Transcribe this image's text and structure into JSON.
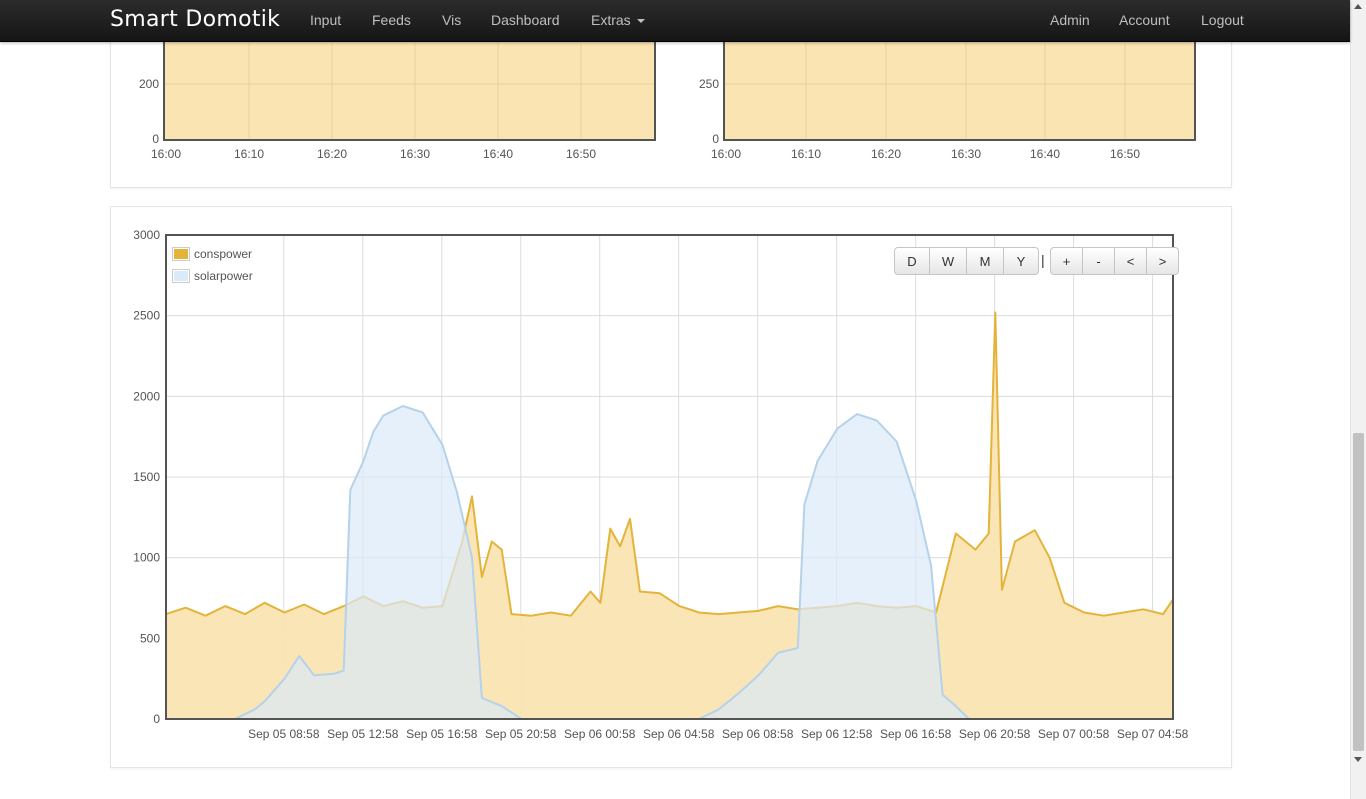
{
  "navbar": {
    "brand": "Smart Domotik",
    "items": [
      "Input",
      "Feeds",
      "Vis",
      "Dashboard",
      "Extras"
    ],
    "right_items": [
      "Admin",
      "Account",
      "Logout"
    ]
  },
  "top_charts": [
    {
      "y_ticks": [
        "0",
        "200"
      ],
      "x_ticks": [
        "16:00",
        "16:10",
        "16:20",
        "16:30",
        "16:40",
        "16:50"
      ]
    },
    {
      "y_ticks": [
        "0",
        "250"
      ],
      "x_ticks": [
        "16:00",
        "16:10",
        "16:20",
        "16:30",
        "16:40",
        "16:50"
      ]
    }
  ],
  "controls": {
    "range_buttons": [
      "D",
      "W",
      "M",
      "Y"
    ],
    "separator": "|",
    "nav_buttons": [
      "+",
      "-",
      "<",
      ">"
    ]
  },
  "colors": {
    "conspower_line": "#e4b43a",
    "conspower_fill": "#f9e4b2",
    "solarpower_line": "#b5d2ea",
    "solarpower_fill": "#dbeaf8"
  },
  "chart_data": {
    "type": "area",
    "legend_position": "top-left",
    "grid": true,
    "ylim": [
      0,
      3000
    ],
    "y_ticks": [
      0,
      500,
      1000,
      1500,
      2000,
      2500,
      3000
    ],
    "x_range": [
      "Sep 05 03:00",
      "Sep 07 06:00"
    ],
    "x_ticks": [
      "Sep 05 08:58",
      "Sep 05 12:58",
      "Sep 05 16:58",
      "Sep 05 20:58",
      "Sep 06 00:58",
      "Sep 06 04:58",
      "Sep 06 08:58",
      "Sep 06 12:58",
      "Sep 06 16:58",
      "Sep 06 20:58",
      "Sep 07 00:58",
      "Sep 07 04:58"
    ],
    "series": [
      {
        "name": "conspower",
        "points": [
          [
            "Sep 05 03:00",
            650
          ],
          [
            "Sep 05 04:00",
            690
          ],
          [
            "Sep 05 05:00",
            640
          ],
          [
            "Sep 05 06:00",
            700
          ],
          [
            "Sep 05 07:00",
            650
          ],
          [
            "Sep 05 08:00",
            720
          ],
          [
            "Sep 05 09:00",
            660
          ],
          [
            "Sep 05 10:00",
            710
          ],
          [
            "Sep 05 11:00",
            650
          ],
          [
            "Sep 05 12:00",
            700
          ],
          [
            "Sep 05 13:00",
            760
          ],
          [
            "Sep 05 14:00",
            700
          ],
          [
            "Sep 05 15:00",
            730
          ],
          [
            "Sep 05 16:00",
            690
          ],
          [
            "Sep 05 17:00",
            700
          ],
          [
            "Sep 05 18:00",
            1100
          ],
          [
            "Sep 05 18:30",
            1380
          ],
          [
            "Sep 05 19:00",
            880
          ],
          [
            "Sep 05 19:30",
            1100
          ],
          [
            "Sep 05 20:00",
            1050
          ],
          [
            "Sep 05 20:30",
            650
          ],
          [
            "Sep 05 21:30",
            640
          ],
          [
            "Sep 05 22:30",
            660
          ],
          [
            "Sep 05 23:30",
            640
          ],
          [
            "Sep 06 00:30",
            790
          ],
          [
            "Sep 06 01:00",
            720
          ],
          [
            "Sep 06 01:30",
            1180
          ],
          [
            "Sep 06 02:00",
            1070
          ],
          [
            "Sep 06 02:30",
            1240
          ],
          [
            "Sep 06 03:00",
            790
          ],
          [
            "Sep 06 04:00",
            780
          ],
          [
            "Sep 06 05:00",
            700
          ],
          [
            "Sep 06 06:00",
            660
          ],
          [
            "Sep 06 07:00",
            650
          ],
          [
            "Sep 06 08:00",
            660
          ],
          [
            "Sep 06 09:00",
            670
          ],
          [
            "Sep 06 10:00",
            700
          ],
          [
            "Sep 06 11:00",
            680
          ],
          [
            "Sep 06 12:00",
            690
          ],
          [
            "Sep 06 13:00",
            700
          ],
          [
            "Sep 06 14:00",
            720
          ],
          [
            "Sep 06 15:00",
            700
          ],
          [
            "Sep 06 16:00",
            690
          ],
          [
            "Sep 06 17:00",
            700
          ],
          [
            "Sep 06 18:00",
            660
          ],
          [
            "Sep 06 19:00",
            1150
          ],
          [
            "Sep 06 20:00",
            1050
          ],
          [
            "Sep 06 20:40",
            1150
          ],
          [
            "Sep 06 21:00",
            2520
          ],
          [
            "Sep 06 21:20",
            800
          ],
          [
            "Sep 06 22:00",
            1100
          ],
          [
            "Sep 06 23:00",
            1170
          ],
          [
            "Sep 06 23:45",
            1000
          ],
          [
            "Sep 07 00:30",
            720
          ],
          [
            "Sep 07 01:30",
            660
          ],
          [
            "Sep 07 02:30",
            640
          ],
          [
            "Sep 07 03:30",
            660
          ],
          [
            "Sep 07 04:30",
            680
          ],
          [
            "Sep 07 05:30",
            650
          ],
          [
            "Sep 07 06:00",
            740
          ]
        ]
      },
      {
        "name": "solarpower",
        "points": [
          [
            "Sep 05 03:00",
            0
          ],
          [
            "Sep 05 06:30",
            0
          ],
          [
            "Sep 05 07:30",
            60
          ],
          [
            "Sep 05 08:00",
            110
          ],
          [
            "Sep 05 09:00",
            250
          ],
          [
            "Sep 05 09:45",
            390
          ],
          [
            "Sep 05 10:30",
            270
          ],
          [
            "Sep 05 11:30",
            280
          ],
          [
            "Sep 05 12:00",
            300
          ],
          [
            "Sep 05 12:20",
            1420
          ],
          [
            "Sep 05 13:00",
            1600
          ],
          [
            "Sep 05 13:30",
            1780
          ],
          [
            "Sep 05 14:00",
            1880
          ],
          [
            "Sep 05 15:00",
            1940
          ],
          [
            "Sep 05 16:00",
            1900
          ],
          [
            "Sep 05 17:00",
            1700
          ],
          [
            "Sep 05 17:45",
            1400
          ],
          [
            "Sep 05 18:30",
            1000
          ],
          [
            "Sep 05 19:00",
            130
          ],
          [
            "Sep 05 20:00",
            80
          ],
          [
            "Sep 05 21:00",
            0
          ],
          [
            "Sep 06 06:00",
            0
          ],
          [
            "Sep 06 07:00",
            60
          ],
          [
            "Sep 06 08:00",
            160
          ],
          [
            "Sep 06 09:00",
            270
          ],
          [
            "Sep 06 10:00",
            410
          ],
          [
            "Sep 06 11:00",
            440
          ],
          [
            "Sep 06 11:20",
            1330
          ],
          [
            "Sep 06 12:00",
            1600
          ],
          [
            "Sep 06 13:00",
            1800
          ],
          [
            "Sep 06 14:00",
            1890
          ],
          [
            "Sep 06 15:00",
            1850
          ],
          [
            "Sep 06 16:00",
            1720
          ],
          [
            "Sep 06 17:00",
            1350
          ],
          [
            "Sep 06 17:45",
            950
          ],
          [
            "Sep 06 18:20",
            150
          ],
          [
            "Sep 06 19:00",
            80
          ],
          [
            "Sep 06 19:40",
            0
          ],
          [
            "Sep 07 06:00",
            0
          ]
        ]
      }
    ]
  }
}
